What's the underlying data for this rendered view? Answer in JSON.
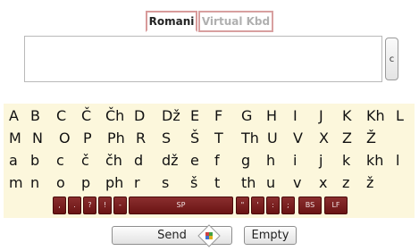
{
  "tabs": [
    "Romani",
    "Virtual Kbd"
  ],
  "text_input": {
    "value": ""
  },
  "clear_label": "c",
  "keyboard_rows": [
    [
      "A",
      "B",
      "C",
      "Č",
      "Čh",
      "D",
      "Dž",
      "E",
      "F",
      "G",
      "H",
      "I",
      "J",
      "K",
      "Kh",
      "L"
    ],
    [
      "M",
      "N",
      "O",
      "P",
      "Ph",
      "R",
      "S",
      "Š",
      "T",
      "Th",
      "U",
      "V",
      "X",
      "Z",
      "Ž"
    ],
    [
      "a",
      "b",
      "c",
      "č",
      "čh",
      "d",
      "dž",
      "e",
      "f",
      "g",
      "h",
      "i",
      "j",
      "k",
      "kh",
      "l"
    ],
    [
      "m",
      "n",
      "o",
      "p",
      "ph",
      "r",
      "s",
      "š",
      "t",
      "th",
      "u",
      "v",
      "x",
      "z",
      "ž"
    ]
  ],
  "function_keys": [
    ",",
    ".",
    "?",
    "!",
    "-",
    "SP",
    "\"",
    "'",
    ":",
    ";",
    "BS",
    "LF"
  ],
  "buttons": {
    "send": "Send",
    "empty": "Empty"
  }
}
